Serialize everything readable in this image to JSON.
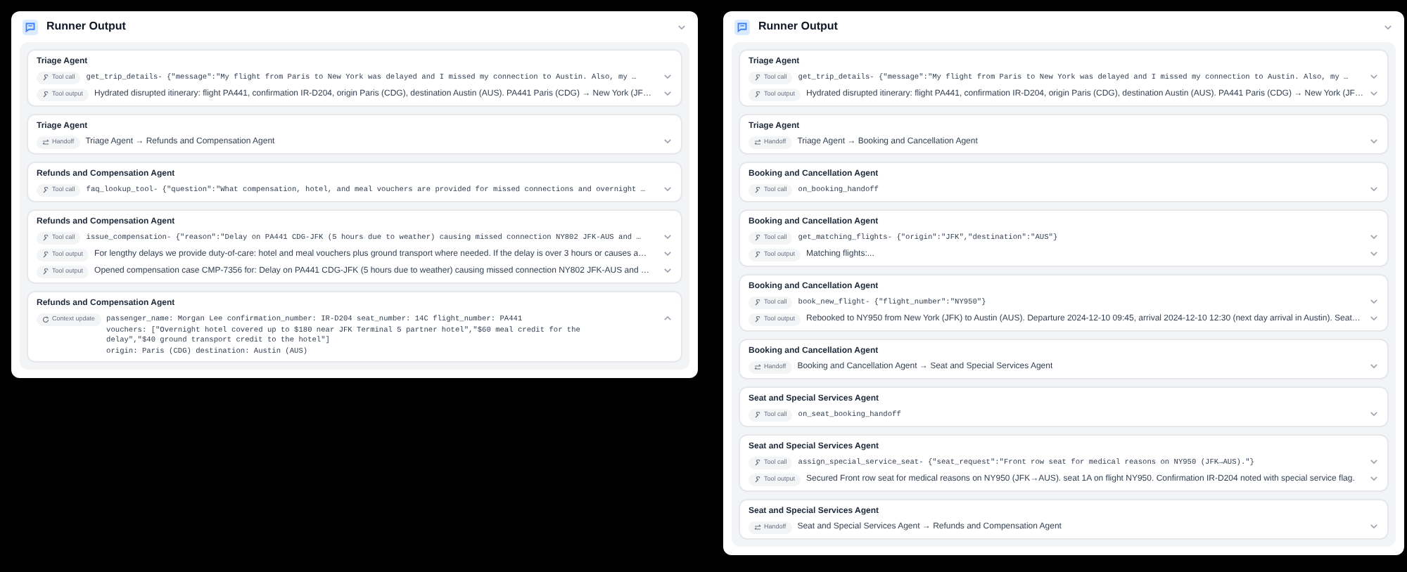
{
  "panels": [
    {
      "title": "Runner Output",
      "cards": [
        {
          "agent": "Triage Agent",
          "items": [
            {
              "kind": "tool_call",
              "badge": "Tool call",
              "text": "get_trip_details- {\"message\":\"My flight from Paris to New York was delayed and I missed my connection to Austin. Also, my …",
              "expanded": false
            },
            {
              "kind": "tool_output",
              "badge": "Tool output",
              "text": "Hydrated disrupted itinerary: flight PA441, confirmation IR-D204, origin Paris (CDG), destination Austin (AUS). PA441 Paris (CDG) → New York (JF…",
              "expanded": false
            }
          ]
        },
        {
          "agent": "Triage Agent",
          "items": [
            {
              "kind": "handoff",
              "badge": "Handoff",
              "text": "Triage Agent → Refunds and Compensation Agent",
              "expanded": false
            }
          ]
        },
        {
          "agent": "Refunds and Compensation Agent",
          "items": [
            {
              "kind": "tool_call",
              "badge": "Tool call",
              "text": "faq_lookup_tool- {\"question\":\"What compensation, hotel, and meal vouchers are provided for missed connections and overnight …",
              "expanded": false
            }
          ]
        },
        {
          "agent": "Refunds and Compensation Agent",
          "items": [
            {
              "kind": "tool_call",
              "badge": "Tool call",
              "text": "issue_compensation- {\"reason\":\"Delay on PA441 CDG-JFK (5 hours due to weather) causing missed connection NY802 JFK-AUS and …",
              "expanded": false
            },
            {
              "kind": "tool_output",
              "badge": "Tool output",
              "text": "For lengthy delays we provide duty-of-care: hotel and meal vouchers plus ground transport where needed. If the delay is over 3 hours or causes a…",
              "expanded": false
            },
            {
              "kind": "tool_output",
              "badge": "Tool output",
              "text": "Opened compensation case CMP-7356 for: Delay on PA441 CDG-JFK (5 hours due to weather) causing missed connection NY802 JFK-AUS and …",
              "expanded": false
            }
          ]
        },
        {
          "agent": "Refunds and Compensation Agent",
          "items": [
            {
              "kind": "context_update",
              "badge": "Context update",
              "lines": [
                "passenger_name: Morgan Lee confirmation_number: IR-D204 seat_number: 14C flight_number: PA441",
                "vouchers: [\"Overnight hotel covered up to $180 near JFK Terminal 5 partner hotel\",\"$60 meal credit for the delay\",\"$40 ground transport credit to the hotel\"]",
                "origin: Paris (CDG) destination: Austin (AUS)"
              ],
              "expanded": true
            }
          ]
        }
      ]
    },
    {
      "title": "Runner Output",
      "cards": [
        {
          "agent": "Triage Agent",
          "items": [
            {
              "kind": "tool_call",
              "badge": "Tool call",
              "text": "get_trip_details- {\"message\":\"My flight from Paris to New York was delayed and I missed my connection to Austin. Also, my …",
              "expanded": false
            },
            {
              "kind": "tool_output",
              "badge": "Tool output",
              "text": "Hydrated disrupted itinerary: flight PA441, confirmation IR-D204, origin Paris (CDG), destination Austin (AUS). PA441 Paris (CDG) → New York (JF…",
              "expanded": false
            }
          ]
        },
        {
          "agent": "Triage Agent",
          "items": [
            {
              "kind": "handoff",
              "badge": "Handoff",
              "text": "Triage Agent → Booking and Cancellation Agent",
              "expanded": false
            }
          ]
        },
        {
          "agent": "Booking and Cancellation Agent",
          "items": [
            {
              "kind": "tool_call",
              "badge": "Tool call",
              "text": "on_booking_handoff",
              "expanded": false
            }
          ]
        },
        {
          "agent": "Booking and Cancellation Agent",
          "items": [
            {
              "kind": "tool_call",
              "badge": "Tool call",
              "text": "get_matching_flights- {\"origin\":\"JFK\",\"destination\":\"AUS\"}",
              "expanded": false
            },
            {
              "kind": "tool_output",
              "badge": "Tool output",
              "text": "Matching flights:...",
              "expanded": false
            }
          ]
        },
        {
          "agent": "Booking and Cancellation Agent",
          "items": [
            {
              "kind": "tool_call",
              "badge": "Tool call",
              "text": "book_new_flight- {\"flight_number\":\"NY950\"}",
              "expanded": false
            },
            {
              "kind": "tool_output",
              "badge": "Tool output",
              "text": "Rebooked to NY950 from New York (JFK) to Austin (AUS). Departure 2024-12-10 09:45, arrival 2024-12-10 12:30 (next day arrival in Austin). Seat…",
              "expanded": false
            }
          ]
        },
        {
          "agent": "Booking and Cancellation Agent",
          "items": [
            {
              "kind": "handoff",
              "badge": "Handoff",
              "text": "Booking and Cancellation Agent → Seat and Special Services Agent",
              "expanded": false
            }
          ]
        },
        {
          "agent": "Seat and Special Services Agent",
          "items": [
            {
              "kind": "tool_call",
              "badge": "Tool call",
              "text": "on_seat_booking_handoff",
              "expanded": false
            }
          ]
        },
        {
          "agent": "Seat and Special Services Agent",
          "items": [
            {
              "kind": "tool_call",
              "badge": "Tool call",
              "text": "assign_special_service_seat- {\"seat_request\":\"Front row seat for medical reasons on NY950 (JFK→AUS).\"}",
              "expanded": false
            },
            {
              "kind": "tool_output",
              "badge": "Tool output",
              "text": "Secured Front row seat for medical reasons on NY950 (JFK→AUS). seat 1A on flight NY950. Confirmation IR-D204 noted with special service flag.",
              "expanded": false
            }
          ]
        },
        {
          "agent": "Seat and Special Services Agent",
          "items": [
            {
              "kind": "handoff",
              "badge": "Handoff",
              "text": "Seat and Special Services Agent → Refunds and Compensation Agent",
              "expanded": false
            }
          ]
        }
      ]
    }
  ]
}
